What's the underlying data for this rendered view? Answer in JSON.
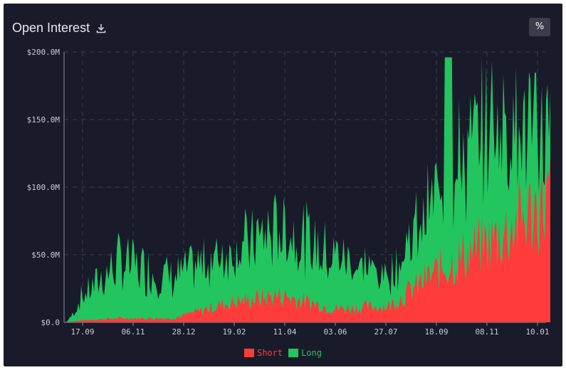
{
  "header": {
    "title": "Open Interest",
    "download_icon": "download-icon",
    "percent_button": "%"
  },
  "colors": {
    "short": "#ff3b3b",
    "long": "#22c55e",
    "background": "#191b2a",
    "grid": "#3a3d50"
  },
  "chart_data": {
    "type": "area",
    "title": "Open Interest",
    "xlabel": "",
    "ylabel": "",
    "ylim": [
      0,
      200
    ],
    "y_unit": "M",
    "y_ticks": [
      "$0.0",
      "$50.0M",
      "$100.0M",
      "$150.0M",
      "$200.0M"
    ],
    "y_tick_values": [
      0,
      50,
      100,
      150,
      200
    ],
    "x_ticks": [
      "17.09",
      "06.11",
      "28.12",
      "19.02",
      "11.04",
      "03.06",
      "27.07",
      "18.09",
      "08.11",
      "10.01"
    ],
    "stacked": true,
    "grid": true,
    "legend": "bottom-center",
    "categories": [
      "17.09",
      "06.11",
      "28.12",
      "19.02",
      "11.04",
      "03.06",
      "27.07",
      "18.09",
      "08.11",
      "10.01"
    ],
    "series": [
      {
        "name": "Short",
        "values": [
          1,
          3,
          3,
          14,
          20,
          10,
          12,
          40,
          62,
          92
        ]
      },
      {
        "name": "Long",
        "values": [
          6,
          42,
          30,
          38,
          50,
          40,
          22,
          60,
          90,
          48
        ]
      }
    ],
    "total_peak": [
      196
    ],
    "legend_labels": [
      "Short",
      "Long"
    ]
  }
}
